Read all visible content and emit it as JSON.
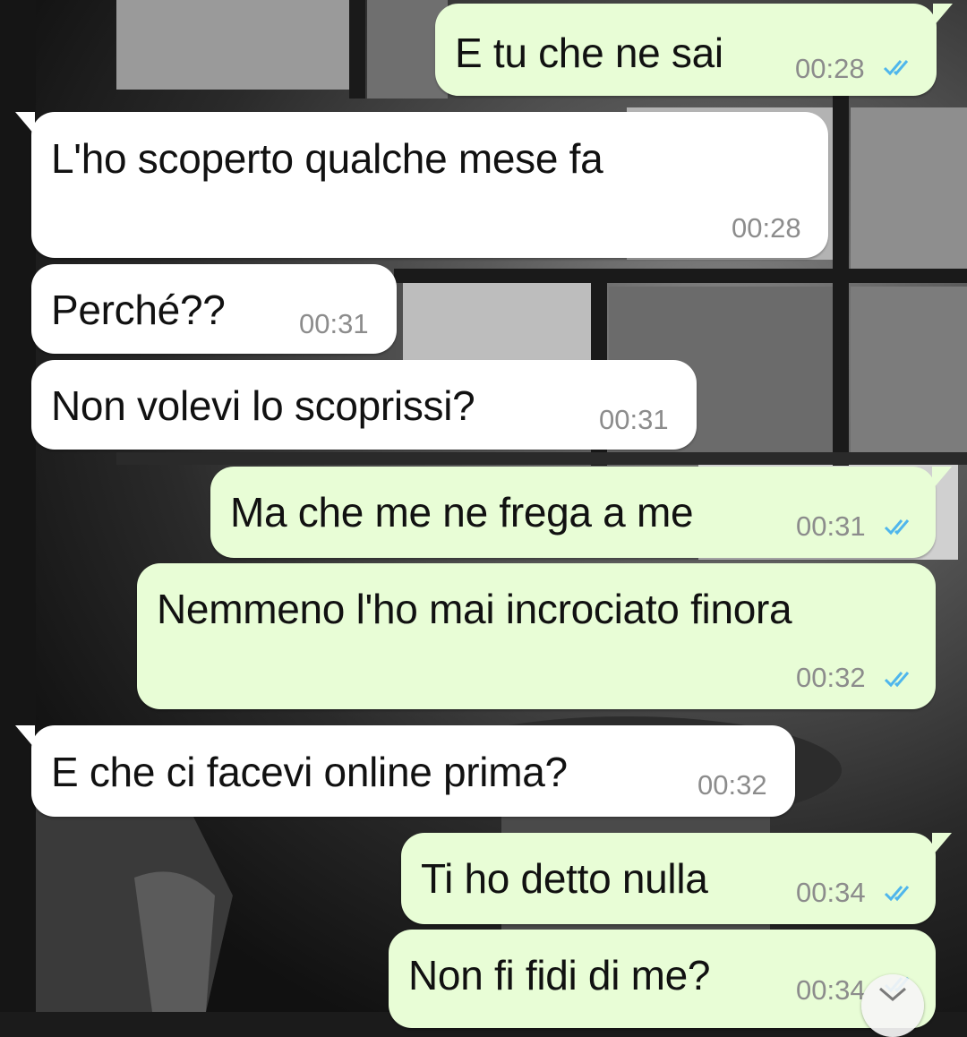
{
  "conversation": {
    "messages": [
      {
        "direction": "outgoing",
        "text": "E tu che ne sai",
        "time": "00:28",
        "status": "read"
      },
      {
        "direction": "incoming",
        "text": "L'ho scoperto qualche mese fa",
        "time": "00:28"
      },
      {
        "direction": "incoming",
        "text": "Perché??",
        "time": "00:31"
      },
      {
        "direction": "incoming",
        "text": "Non volevi lo scoprissi?",
        "time": "00:31"
      },
      {
        "direction": "outgoing",
        "text": "Ma che me ne frega a me",
        "time": "00:31",
        "status": "read"
      },
      {
        "direction": "outgoing",
        "text": "Nemmeno l'ho mai incrociato finora",
        "time": "00:32",
        "status": "read"
      },
      {
        "direction": "incoming",
        "text": "E che ci facevi online prima?",
        "time": "00:32"
      },
      {
        "direction": "outgoing",
        "text": "Ti ho detto nulla",
        "time": "00:34",
        "status": "read"
      },
      {
        "direction": "outgoing",
        "text": "Non fi fidi di me?",
        "time": "00:34",
        "status": "read"
      }
    ]
  },
  "colors": {
    "incoming_bubble": "#ffffff",
    "outgoing_bubble": "#e8fdd6",
    "read_ticks": "#4fb6ec",
    "timestamp": "#8c8c8c"
  },
  "icons": {
    "read_receipt": "double-check-icon",
    "scroll_down": "chevron-down-icon"
  }
}
